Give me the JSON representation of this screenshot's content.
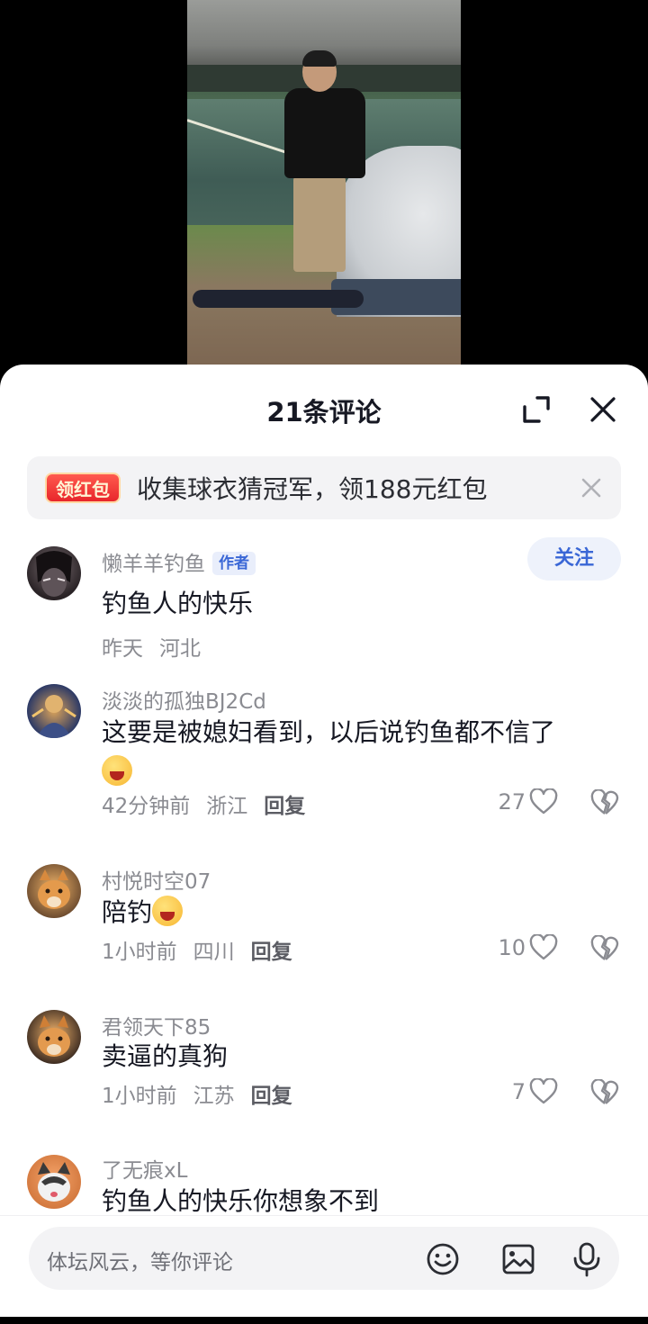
{
  "sheet": {
    "title": "21条评论"
  },
  "promo": {
    "badge": "领红包",
    "text": "收集球衣猜冠军，领188元红包"
  },
  "comments": [
    {
      "name": "懒羊羊钓鱼",
      "tag": "作者",
      "follow": "关注",
      "text": "钓鱼人的快乐",
      "time": "昨天",
      "location": "河北"
    },
    {
      "name": "淡淡的孤独BJ2Cd",
      "text": "这要是被媳妇看到，以后说钓鱼都不信了",
      "time": "42分钟前",
      "location": "浙江",
      "reply": "回复",
      "likes": "27"
    },
    {
      "name": "村悦时空07",
      "text": "陪钓",
      "time": "1小时前",
      "location": "四川",
      "reply": "回复",
      "likes": "10"
    },
    {
      "name": "君领天下85",
      "text": "卖逼的真狗",
      "time": "1小时前",
      "location": "江苏",
      "reply": "回复",
      "likes": "7"
    },
    {
      "name": "了无痕xL",
      "text": "钓鱼人的快乐你想象不到"
    }
  ],
  "input": {
    "placeholder": "体坛风云，等你评论"
  },
  "colors": {
    "accent_blue": "#3a67d6",
    "promo_red": "#e8262b",
    "meta_gray": "#8a8b91"
  },
  "icons": [
    "expand-icon",
    "close-icon",
    "heart-icon",
    "broken-heart-icon",
    "emoji-icon",
    "image-icon",
    "microphone-icon"
  ]
}
